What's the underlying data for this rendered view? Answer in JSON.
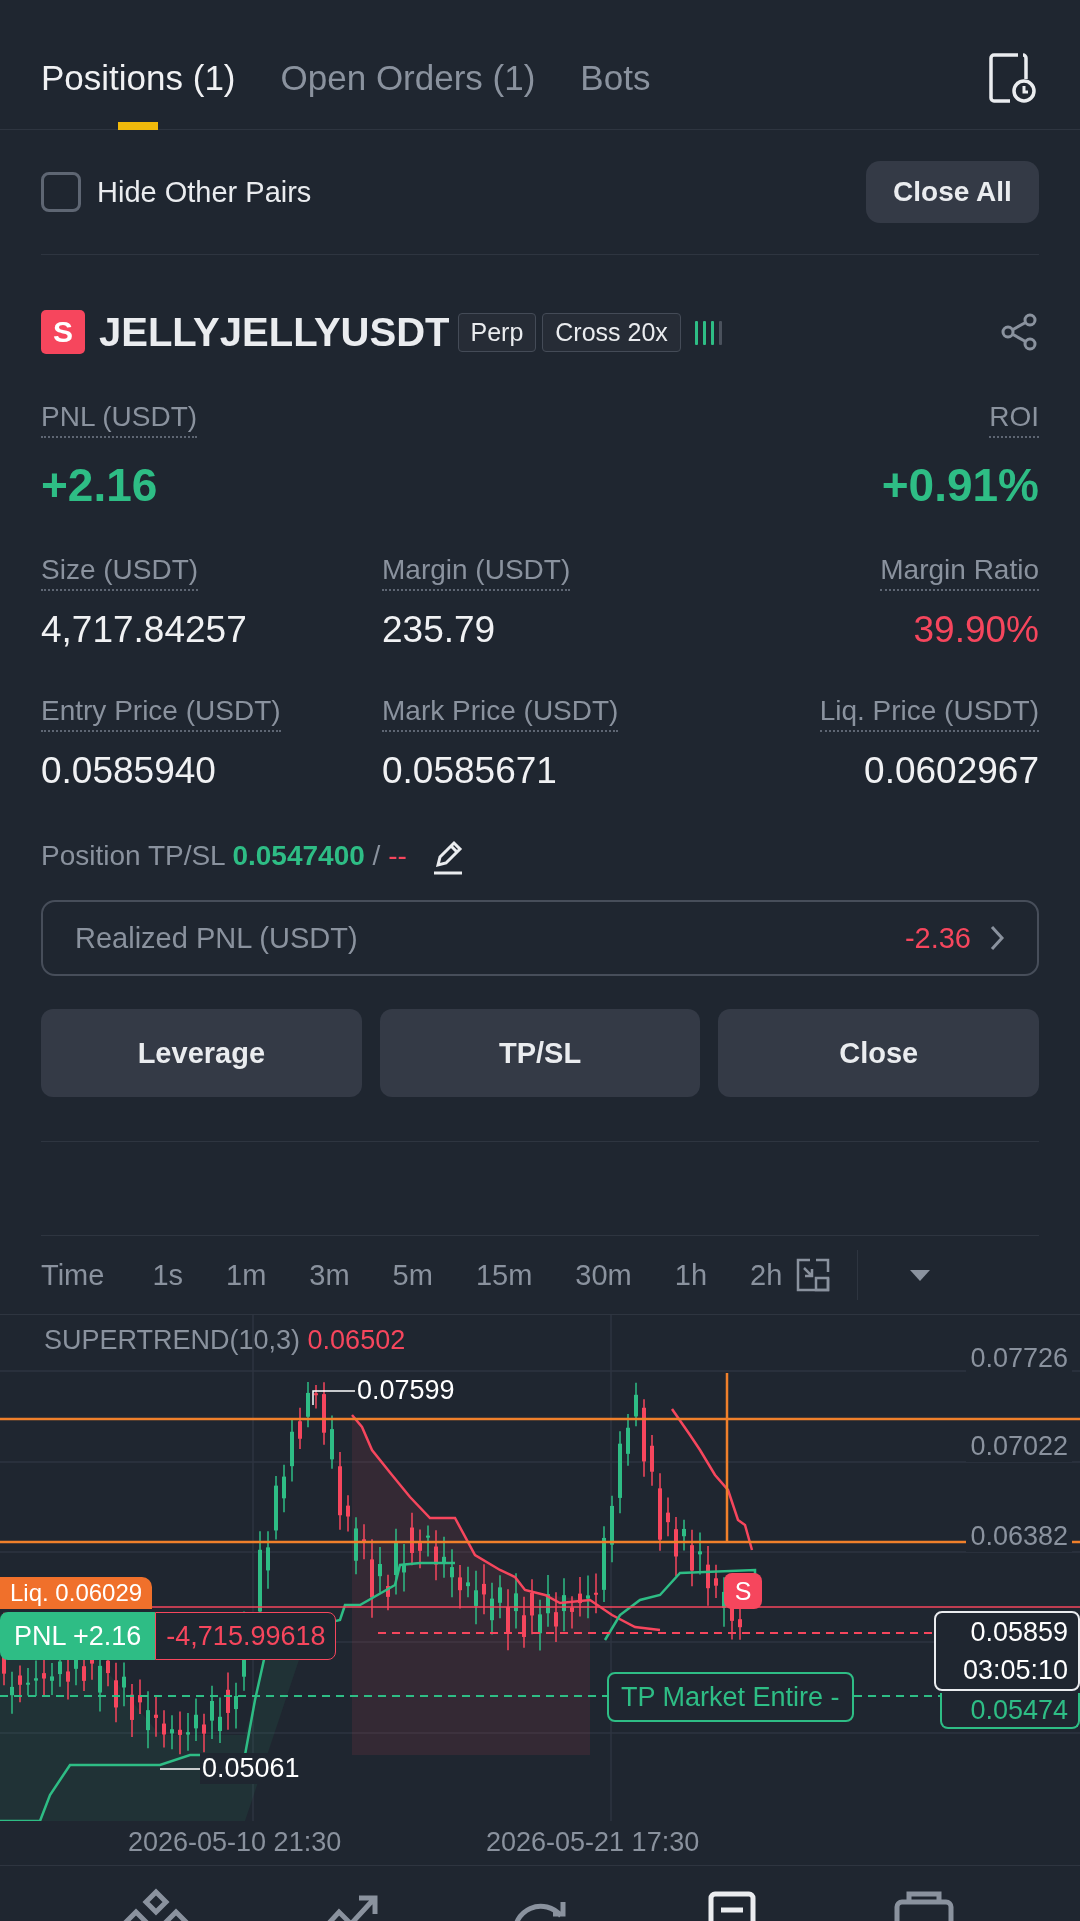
{
  "tabs": [
    {
      "label": "Positions (1)",
      "selected": true
    },
    {
      "label": "Open Orders (1)",
      "selected": false
    },
    {
      "label": "Bots",
      "selected": false
    }
  ],
  "hide_other_pairs": {
    "label": "Hide Other Pairs",
    "checked": false
  },
  "close_all_button": "Close All",
  "position": {
    "side": "S",
    "symbol": "JELLYJELLYUSDT",
    "tags": [
      "Perp",
      "Cross 20x"
    ],
    "adl": {
      "level": 0.75
    },
    "pnl": {
      "label": "PNL (USDT)",
      "value": "+2.16"
    },
    "roi": {
      "label": "ROI",
      "value": "+0.91%"
    },
    "stats": [
      {
        "label": "Size (USDT)",
        "value": "4,717.84257",
        "negative": false
      },
      {
        "label": "Margin (USDT)",
        "value": "235.79",
        "negative": false
      },
      {
        "label": "Margin Ratio",
        "value": "39.90%",
        "negative": true
      },
      {
        "label": "Entry Price (USDT)",
        "value": "0.0585940",
        "negative": false
      },
      {
        "label": "Mark Price (USDT)",
        "value": "0.0585671",
        "negative": false
      },
      {
        "label": "Liq. Price (USDT)",
        "value": "0.0602967",
        "negative": false
      }
    ],
    "tpsl": {
      "label": "Position TP/SL",
      "tp": "0.0547400",
      "separator": "/",
      "sl": "--"
    },
    "realized_pnl": {
      "label": "Realized PNL (USDT)",
      "value": "-2.36"
    },
    "actions": [
      "Leverage",
      "TP/SL",
      "Close"
    ]
  },
  "timeframes": [
    "Time",
    "1s",
    "1m",
    "3m",
    "5m",
    "15m",
    "30m",
    "1h",
    "2h"
  ],
  "chart": {
    "indicator": "SUPERTREND(10,3)",
    "indicator_value": "0.06502",
    "price_ticks": [
      "0.07726",
      "0.07022",
      "0.06382"
    ],
    "high_label": "0.07599",
    "low_label": "0.05061",
    "liq_label": "Liq. 0.06029",
    "pnl_tag": "PNL +2.16",
    "pnl_amount": "-4,715.99618",
    "trade_marker": "S",
    "last_price": "0.05859",
    "countdown": "03:05:10",
    "tp_label": "TP Market Entire -",
    "tp_price": "0.05474",
    "dates": [
      "2026-05-10 21:30",
      "2026-05-21 17:30"
    ]
  }
}
